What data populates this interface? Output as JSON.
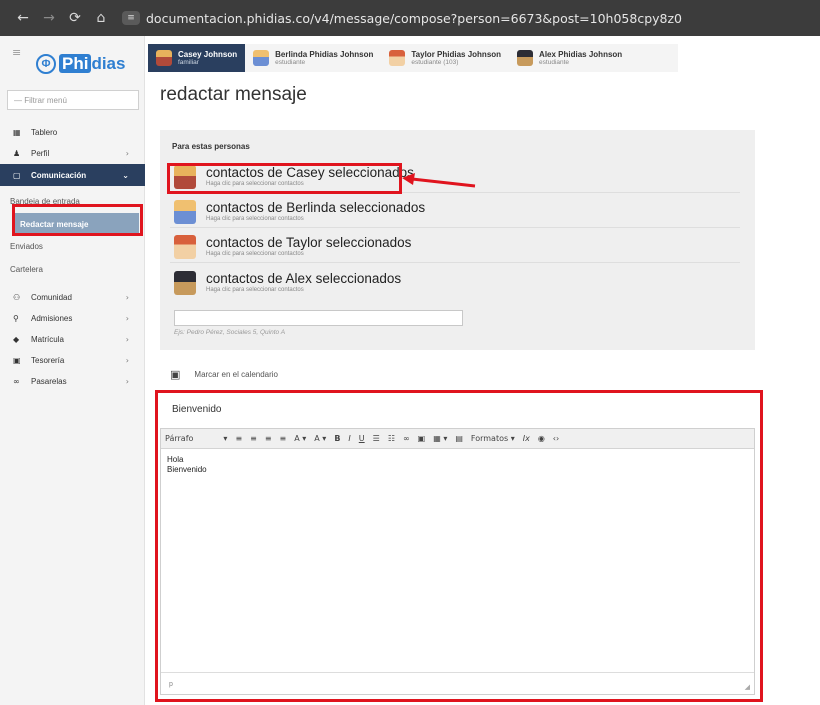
{
  "browser": {
    "back": "←",
    "forward": "→",
    "reload": "⟳",
    "home": "⌂",
    "site_icon": "≡",
    "url": "documentacion.phidias.co/v4/message/compose?person=6673&post=10h058cpy8z0"
  },
  "sidebar": {
    "menu_toggle": "≡",
    "logo_mark": "Φ",
    "logo_prefix": "Phi",
    "logo_suffix": "dias",
    "filter_placeholder": "— Filtrar menú",
    "items": [
      {
        "icon": "▦",
        "label": "Tablero",
        "chevron": ""
      },
      {
        "icon": "♟",
        "label": "Perfil",
        "chevron": "›"
      },
      {
        "icon": "▢",
        "label": "Comunicación",
        "chevron": "⌄"
      }
    ],
    "sub_items": [
      "Bandeja de entrada",
      "Redactar mensaje",
      "Enviados",
      "Cartelera"
    ],
    "items_after": [
      {
        "icon": "⚇",
        "label": "Comunidad",
        "chevron": "›"
      },
      {
        "icon": "⚲",
        "label": "Admisiones",
        "chevron": "›"
      },
      {
        "icon": "◆",
        "label": "Matrícula",
        "chevron": "›"
      },
      {
        "icon": "▣",
        "label": "Tesorería",
        "chevron": "›"
      },
      {
        "icon": "∞",
        "label": "Pasarelas",
        "chevron": "›"
      }
    ]
  },
  "person_tabs": [
    {
      "name": "Casey Johnson",
      "role": "familiar"
    },
    {
      "name": "Berlinda Phidias Johnson",
      "role": "estudiante"
    },
    {
      "name": "Taylor Phidias Johnson",
      "role": "estudiante (103)"
    },
    {
      "name": "Alex Phidias Johnson",
      "role": "estudiante"
    }
  ],
  "page_title": "redactar mensaje",
  "recipients": {
    "heading": "Para estas personas",
    "rows": [
      {
        "title": "contactos de Casey seleccionados",
        "subtitle": "Haga clic para seleccionar contactos"
      },
      {
        "title": "contactos de Berlinda seleccionados",
        "subtitle": "Haga clic para seleccionar contactos"
      },
      {
        "title": "contactos de Taylor seleccionados",
        "subtitle": "Haga clic para seleccionar contactos"
      },
      {
        "title": "contactos de Alex seleccionados",
        "subtitle": "Haga clic para seleccionar contactos"
      }
    ],
    "search_value": "",
    "search_hint": "Ejs: Pedro Pérez, Sociales 5, Quinto A"
  },
  "calendar": {
    "icon": "▣",
    "label": "Marcar en el calendario"
  },
  "editor": {
    "subject": "Bienvenido",
    "toolbar": {
      "paragraph": "Párrafo",
      "paragraph_caret": "▾",
      "align_left": "≡",
      "align_center": "≡",
      "align_right": "≡",
      "justify": "≡",
      "text_color": "A ▾",
      "bg_color": "A ▾",
      "bold": "B",
      "italic": "I",
      "underline": "U",
      "bullet_list": "☰",
      "numbered_list": "☷",
      "link": "∞",
      "image": "▣",
      "table": "▦ ▾",
      "media": "▤",
      "formats": "Formatos ▾",
      "clear": "Ix",
      "preview": "◉",
      "code": "‹›"
    },
    "body_lines": [
      "Hola",
      "Bienvenido"
    ],
    "status_path": "p",
    "resize_grip": "◢"
  },
  "colors": {
    "accent": "#2a3f5f",
    "highlight": "#e0141e",
    "selected_sub": "#8aa3bd",
    "logo": "#2f7fd1"
  }
}
